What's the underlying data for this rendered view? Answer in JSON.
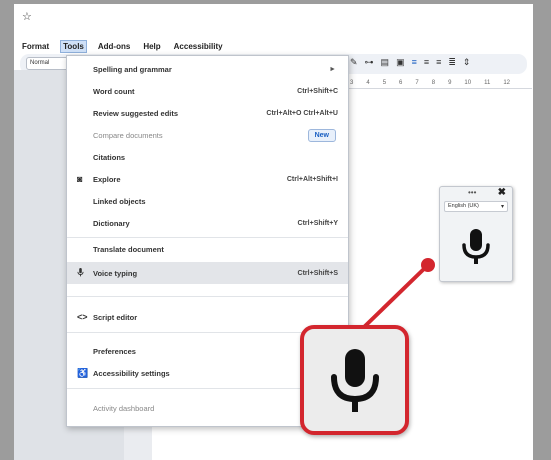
{
  "menubar": {
    "items": [
      {
        "label": "Format",
        "active": false
      },
      {
        "label": "Tools",
        "active": true
      },
      {
        "label": "Add-ons",
        "active": false
      },
      {
        "label": "Help",
        "active": false
      },
      {
        "label": "Accessibility",
        "active": false
      }
    ]
  },
  "toolbar": {
    "style_value": "Normal"
  },
  "ruler": {
    "ticks": [
      "3",
      "4",
      "5",
      "6",
      "7",
      "8",
      "9",
      "10",
      "11",
      "12"
    ]
  },
  "tools_menu": {
    "spelling": {
      "label": "Spelling and grammar"
    },
    "word_count": {
      "label": "Word count",
      "shortcut": "Ctrl+Shift+C"
    },
    "review": {
      "label": "Review suggested edits",
      "shortcut": "Ctrl+Alt+O Ctrl+Alt+U"
    },
    "compare": {
      "label": "Compare documents",
      "badge": "New"
    },
    "citations": {
      "label": "Citations"
    },
    "explore": {
      "label": "Explore",
      "shortcut": "Ctrl+Alt+Shift+I"
    },
    "linked": {
      "label": "Linked objects"
    },
    "dictionary": {
      "label": "Dictionary",
      "shortcut": "Ctrl+Shift+Y"
    },
    "translate": {
      "label": "Translate document"
    },
    "voice": {
      "label": "Voice typing",
      "shortcut": "Ctrl+Shift+S"
    },
    "script": {
      "label": "Script editor"
    },
    "preferences": {
      "label": "Preferences"
    },
    "accessibility": {
      "label": "Accessibility settings"
    },
    "activity": {
      "label": "Activity dashboard"
    }
  },
  "voice_widget": {
    "language": "English (UK)",
    "dots": "•••",
    "close": "✖"
  },
  "colors": {
    "highlight_border": "#d3262e",
    "accent_blue": "#1a5fc2"
  },
  "icons": [
    "star-icon",
    "pen-icon",
    "link-icon",
    "comment-icon",
    "image-icon",
    "align-left-icon",
    "align-center-icon",
    "align-right-icon",
    "align-justify-icon",
    "line-spacing-icon",
    "explore-icon",
    "microphone-icon",
    "code-icon",
    "accessibility-icon",
    "close-icon",
    "chevron-down-icon",
    "submenu-arrow-icon"
  ]
}
